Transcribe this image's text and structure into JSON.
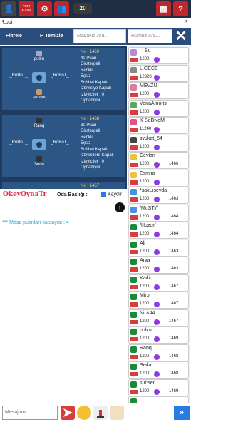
{
  "topbar": {
    "newtable_label": "YENİ\nMASA",
    "coins": "20"
  },
  "tabs": {
    "lobi": "Lobi"
  },
  "filters": {
    "filtrele": "Filtrele",
    "temizle": "F. Temizle",
    "masano_placeholder": "MasaNo Ara...",
    "rumuz_placeholder": "Rumuz Ara..."
  },
  "tables": [
    {
      "seats": {
        "top": "pulim",
        "left": "_RoBoT_",
        "right": "_RoBoT_",
        "bottom": "sunset"
      },
      "info": [
        "No : 1469",
        "40 Puan",
        "Göstergeli",
        "Renkli",
        "Eşsiz",
        "Sohbet Kapalı",
        "İzleyiciye Kapalı",
        "İzleyiciler : 0",
        "Oynanıyor"
      ]
    },
    {
      "seats": {
        "top": "Ranq",
        "left": "_RoBoT_",
        "right": "_RoBoT_",
        "bottom": "Seda"
      },
      "info": [
        "No : 1468",
        "30 Puan",
        "Göstergeli",
        "Renkli",
        "Eşsiz",
        "Sohbet Kapalı",
        "İzleyicilere Kapalı",
        "İzleyiciler : 0",
        "Oynanıyor"
      ]
    },
    {
      "info": [
        "No : 1467"
      ]
    }
  ],
  "chat": {
    "logo": "OkeyOynaTr",
    "oda_label": "Oda Başlığı :",
    "kaydir_label": "Kaydır",
    "puan_message": "*** Masa puanları katsayısı : 4",
    "input_placeholder": "Mesajınız..."
  },
  "players": [
    {
      "name": "—Su—",
      "pts": "1200",
      "lvl": "",
      "av": "#b58ad8"
    },
    {
      "name": "L.GECE",
      "pts": "12328",
      "lvl": "",
      "av": "#888"
    },
    {
      "name": "MEVZU",
      "pts": "1200",
      "lvl": "",
      "av": "#e07aa0"
    },
    {
      "name": "VenaAmoris",
      "pts": "1200",
      "lvl": "",
      "av": "#5a6"
    },
    {
      "name": "K-SeBNeM",
      "pts": "11240",
      "lvl": "",
      "av": "#d58"
    },
    {
      "name": "svukat_54",
      "pts": "1200",
      "lvl": "",
      "av": "#444"
    },
    {
      "name": "Ceylan",
      "pts": "1200",
      "lvl": "1466",
      "av": "#f0c040"
    },
    {
      "name": "Esmira",
      "pts": "1200",
      "lvl": "",
      "av": "#f0c040"
    },
    {
      "name": "*sakLısevda",
      "pts": "1200",
      "lvl": "1463",
      "av": "#4a90e2"
    },
    {
      "name": "/MuSTi//",
      "pts": "1200",
      "lvl": "1464",
      "av": "#4a90e2"
    },
    {
      "name": "/Huzur/",
      "pts": "1200",
      "lvl": "1464",
      "av": "#1a8a3a"
    },
    {
      "name": "Ali",
      "pts": "1200",
      "lvl": "1463",
      "av": "#1a8a3a"
    },
    {
      "name": "Arya",
      "pts": "1200",
      "lvl": "1463",
      "av": "#1a8a3a"
    },
    {
      "name": "Kadir",
      "pts": "1200",
      "lvl": "1467",
      "av": "#1a8a3a"
    },
    {
      "name": "Miro",
      "pts": "1200",
      "lvl": "1467",
      "av": "#1a8a3a"
    },
    {
      "name": "Nick44",
      "pts": "1200",
      "lvl": "1467",
      "av": "#1a8a3a"
    },
    {
      "name": "pulim",
      "pts": "1200",
      "lvl": "1469",
      "av": "#1a8a3a"
    },
    {
      "name": "Ranq",
      "pts": "1200",
      "lvl": "1468",
      "av": "#1a8a3a"
    },
    {
      "name": "Seda",
      "pts": "1200",
      "lvl": "1468",
      "av": "#1a8a3a"
    },
    {
      "name": "sunset",
      "pts": "1200",
      "lvl": "1469",
      "av": "#1a8a3a"
    },
    {
      "name": "",
      "pts": "1200",
      "lvl": "",
      "av": "#1a8a3a"
    }
  ]
}
